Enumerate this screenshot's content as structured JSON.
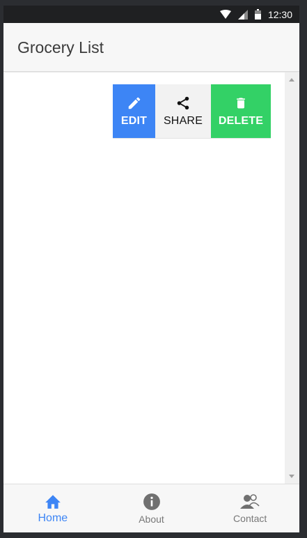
{
  "status_bar": {
    "time": "12:30",
    "icons": [
      "wifi-icon",
      "signal-icon",
      "battery-icon"
    ]
  },
  "app_bar": {
    "title": "Grocery List"
  },
  "swipe_actions": [
    {
      "label": "EDIT",
      "icon": "pencil-icon",
      "color": "#3d85f5"
    },
    {
      "label": "SHARE",
      "icon": "share-icon",
      "color": "#f2f2f2"
    },
    {
      "label": "DELETE",
      "icon": "trash-icon",
      "color": "#33d166"
    }
  ],
  "fab": {
    "icon": "plus-icon",
    "color": "#3d85f5"
  },
  "bottom_nav": {
    "items": [
      {
        "label": "Home",
        "icon": "home-icon",
        "active": true
      },
      {
        "label": "About",
        "icon": "info-icon",
        "active": false
      },
      {
        "label": "Contact",
        "icon": "contact-icon",
        "active": false
      }
    ]
  },
  "colors": {
    "accent": "#3d85f5",
    "delete": "#33d166",
    "status_bar": "#1f2022"
  }
}
